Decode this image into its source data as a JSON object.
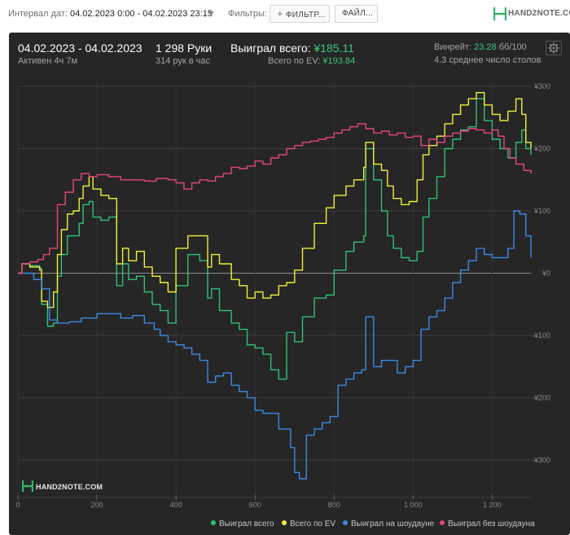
{
  "topbar": {
    "interval_label": "Интервал дат:",
    "date_range": "04.02.2023 0:00 - 04.02.2023 23:15",
    "filters_label": "Фильтры:",
    "filter_button": "ФИЛЬТР...",
    "file_button": "ФАЙЛ...",
    "brand": "HAND2NOTE.COM"
  },
  "summary": {
    "date": "04.02.2023 - 04.02.2023",
    "active": "Активен 4ч 7м",
    "hands": "1 298 Руки",
    "hands_rate": "314 рук в час",
    "won_label": "Выиграл всего:",
    "won_value": "¥185.11",
    "ev_label": "Всего по EV:",
    "ev_value": "¥193.84",
    "winrate_label": "Винрейт:",
    "winrate_value": "23.28",
    "winrate_unit": "бб/100",
    "tables": "4.3 среднее число столов"
  },
  "watermark": "HAND2NOTE.COM",
  "colors": {
    "green": "#2fc274",
    "yellow": "#f1f03a",
    "blue": "#3b8ae6",
    "pink": "#e5467e",
    "panel": "#262626"
  },
  "chart_data": {
    "type": "line",
    "xlabel": "",
    "ylabel": "",
    "xlim": [
      0,
      1298
    ],
    "ylim": [
      -360,
      300
    ],
    "x_ticks": [
      0,
      200,
      400,
      600,
      800,
      1000,
      1200
    ],
    "x_tick_labels": [
      "0",
      "200",
      "400",
      "600",
      "800",
      "1 000",
      "1 200"
    ],
    "y_ticks": [
      300,
      200,
      100,
      0,
      -100,
      -200,
      -300
    ],
    "y_tick_labels": [
      "¥300",
      "¥200",
      "¥100",
      "¥0",
      "-¥100",
      "-¥200",
      "-¥300"
    ],
    "legend_position": "bottom-right",
    "series": [
      {
        "name": "Выиграл всего",
        "color": "#2fc274",
        "points": [
          [
            0,
            0
          ],
          [
            10,
            15
          ],
          [
            30,
            12
          ],
          [
            55,
            8
          ],
          [
            60,
            -50
          ],
          [
            75,
            -85
          ],
          [
            90,
            -80
          ],
          [
            100,
            -5
          ],
          [
            110,
            30
          ],
          [
            125,
            60
          ],
          [
            140,
            60
          ],
          [
            155,
            80
          ],
          [
            165,
            110
          ],
          [
            180,
            115
          ],
          [
            190,
            90
          ],
          [
            210,
            85
          ],
          [
            230,
            90
          ],
          [
            250,
            -20
          ],
          [
            265,
            15
          ],
          [
            280,
            -10
          ],
          [
            300,
            -5
          ],
          [
            320,
            -30
          ],
          [
            340,
            -50
          ],
          [
            360,
            -60
          ],
          [
            380,
            -80
          ],
          [
            400,
            -20
          ],
          [
            430,
            30
          ],
          [
            460,
            20
          ],
          [
            480,
            -40
          ],
          [
            490,
            -25
          ],
          [
            510,
            -60
          ],
          [
            540,
            -80
          ],
          [
            560,
            -90
          ],
          [
            580,
            -115
          ],
          [
            600,
            -120
          ],
          [
            620,
            -130
          ],
          [
            640,
            -155
          ],
          [
            660,
            -170
          ],
          [
            680,
            -95
          ],
          [
            700,
            -110
          ],
          [
            720,
            -70
          ],
          [
            750,
            -40
          ],
          [
            780,
            -35
          ],
          [
            800,
            5
          ],
          [
            830,
            35
          ],
          [
            850,
            50
          ],
          [
            875,
            60
          ],
          [
            880,
            200
          ],
          [
            900,
            150
          ],
          [
            920,
            100
          ],
          [
            935,
            60
          ],
          [
            950,
            40
          ],
          [
            970,
            25
          ],
          [
            990,
            20
          ],
          [
            1010,
            35
          ],
          [
            1025,
            90
          ],
          [
            1040,
            120
          ],
          [
            1060,
            155
          ],
          [
            1080,
            200
          ],
          [
            1100,
            215
          ],
          [
            1120,
            230
          ],
          [
            1140,
            235
          ],
          [
            1160,
            280
          ],
          [
            1180,
            245
          ],
          [
            1200,
            215
          ],
          [
            1220,
            200
          ],
          [
            1240,
            185
          ],
          [
            1260,
            210
          ],
          [
            1275,
            230
          ],
          [
            1285,
            200
          ],
          [
            1298,
            190
          ]
        ]
      },
      {
        "name": "Всего по EV",
        "color": "#f1f03a",
        "points": [
          [
            0,
            0
          ],
          [
            10,
            15
          ],
          [
            30,
            10
          ],
          [
            55,
            5
          ],
          [
            60,
            -45
          ],
          [
            75,
            -55
          ],
          [
            90,
            -30
          ],
          [
            100,
            30
          ],
          [
            110,
            70
          ],
          [
            125,
            95
          ],
          [
            140,
            100
          ],
          [
            155,
            120
          ],
          [
            165,
            140
          ],
          [
            180,
            155
          ],
          [
            190,
            135
          ],
          [
            210,
            125
          ],
          [
            230,
            120
          ],
          [
            250,
            15
          ],
          [
            265,
            40
          ],
          [
            280,
            20
          ],
          [
            300,
            35
          ],
          [
            320,
            10
          ],
          [
            340,
            -5
          ],
          [
            360,
            -15
          ],
          [
            380,
            -30
          ],
          [
            400,
            40
          ],
          [
            430,
            60
          ],
          [
            460,
            60
          ],
          [
            480,
            10
          ],
          [
            490,
            30
          ],
          [
            510,
            15
          ],
          [
            540,
            -10
          ],
          [
            560,
            -20
          ],
          [
            580,
            -40
          ],
          [
            600,
            -30
          ],
          [
            620,
            -40
          ],
          [
            640,
            -35
          ],
          [
            660,
            -20
          ],
          [
            680,
            -15
          ],
          [
            700,
            5
          ],
          [
            720,
            40
          ],
          [
            750,
            80
          ],
          [
            780,
            105
          ],
          [
            800,
            125
          ],
          [
            830,
            140
          ],
          [
            850,
            150
          ],
          [
            875,
            170
          ],
          [
            880,
            210
          ],
          [
            900,
            175
          ],
          [
            920,
            165
          ],
          [
            935,
            140
          ],
          [
            950,
            120
          ],
          [
            970,
            110
          ],
          [
            990,
            115
          ],
          [
            1010,
            150
          ],
          [
            1025,
            190
          ],
          [
            1040,
            205
          ],
          [
            1060,
            220
          ],
          [
            1080,
            240
          ],
          [
            1100,
            255
          ],
          [
            1120,
            270
          ],
          [
            1140,
            280
          ],
          [
            1160,
            290
          ],
          [
            1180,
            270
          ],
          [
            1200,
            255
          ],
          [
            1220,
            245
          ],
          [
            1240,
            260
          ],
          [
            1260,
            280
          ],
          [
            1275,
            255
          ],
          [
            1285,
            210
          ],
          [
            1298,
            200
          ]
        ]
      },
      {
        "name": "Выиграл на шоудауне",
        "color": "#3b8ae6",
        "points": [
          [
            0,
            0
          ],
          [
            10,
            0
          ],
          [
            40,
            -10
          ],
          [
            60,
            -25
          ],
          [
            80,
            -75
          ],
          [
            100,
            -80
          ],
          [
            130,
            -78
          ],
          [
            160,
            -72
          ],
          [
            200,
            -65
          ],
          [
            230,
            -65
          ],
          [
            260,
            -72
          ],
          [
            290,
            -68
          ],
          [
            320,
            -80
          ],
          [
            345,
            -90
          ],
          [
            360,
            -100
          ],
          [
            380,
            -110
          ],
          [
            400,
            -115
          ],
          [
            420,
            -120
          ],
          [
            440,
            -130
          ],
          [
            460,
            -140
          ],
          [
            480,
            -175
          ],
          [
            500,
            -165
          ],
          [
            520,
            -160
          ],
          [
            540,
            -180
          ],
          [
            560,
            -190
          ],
          [
            580,
            -200
          ],
          [
            600,
            -220
          ],
          [
            620,
            -225
          ],
          [
            640,
            -225
          ],
          [
            660,
            -250
          ],
          [
            680,
            -250
          ],
          [
            690,
            -280
          ],
          [
            700,
            -320
          ],
          [
            712,
            -330
          ],
          [
            730,
            -260
          ],
          [
            750,
            -250
          ],
          [
            770,
            -240
          ],
          [
            790,
            -230
          ],
          [
            810,
            -180
          ],
          [
            830,
            -170
          ],
          [
            850,
            -160
          ],
          [
            870,
            -155
          ],
          [
            880,
            -70
          ],
          [
            900,
            -150
          ],
          [
            920,
            -140
          ],
          [
            940,
            -140
          ],
          [
            960,
            -160
          ],
          [
            980,
            -150
          ],
          [
            1000,
            -140
          ],
          [
            1020,
            -90
          ],
          [
            1040,
            -70
          ],
          [
            1060,
            -60
          ],
          [
            1080,
            -40
          ],
          [
            1100,
            -15
          ],
          [
            1120,
            5
          ],
          [
            1140,
            20
          ],
          [
            1160,
            40
          ],
          [
            1180,
            30
          ],
          [
            1200,
            25
          ],
          [
            1220,
            25
          ],
          [
            1240,
            40
          ],
          [
            1255,
            100
          ],
          [
            1270,
            95
          ],
          [
            1285,
            60
          ],
          [
            1298,
            25
          ]
        ]
      },
      {
        "name": "Выиграл без шоудауна",
        "color": "#e5467e",
        "points": [
          [
            0,
            0
          ],
          [
            10,
            15
          ],
          [
            30,
            18
          ],
          [
            50,
            22
          ],
          [
            65,
            30
          ],
          [
            80,
            40
          ],
          [
            100,
            110
          ],
          [
            120,
            130
          ],
          [
            140,
            150
          ],
          [
            160,
            160
          ],
          [
            180,
            155
          ],
          [
            200,
            158
          ],
          [
            230,
            155
          ],
          [
            260,
            150
          ],
          [
            290,
            150
          ],
          [
            320,
            148
          ],
          [
            350,
            152
          ],
          [
            380,
            150
          ],
          [
            400,
            145
          ],
          [
            420,
            135
          ],
          [
            440,
            145
          ],
          [
            460,
            150
          ],
          [
            480,
            148
          ],
          [
            500,
            155
          ],
          [
            520,
            160
          ],
          [
            540,
            170
          ],
          [
            560,
            168
          ],
          [
            580,
            172
          ],
          [
            600,
            180
          ],
          [
            620,
            175
          ],
          [
            640,
            185
          ],
          [
            660,
            190
          ],
          [
            680,
            200
          ],
          [
            700,
            205
          ],
          [
            720,
            210
          ],
          [
            740,
            212
          ],
          [
            760,
            215
          ],
          [
            780,
            218
          ],
          [
            800,
            225
          ],
          [
            820,
            230
          ],
          [
            840,
            235
          ],
          [
            860,
            240
          ],
          [
            880,
            232
          ],
          [
            900,
            225
          ],
          [
            920,
            228
          ],
          [
            940,
            222
          ],
          [
            960,
            225
          ],
          [
            980,
            218
          ],
          [
            1000,
            220
          ],
          [
            1020,
            205
          ],
          [
            1040,
            215
          ],
          [
            1060,
            210
          ],
          [
            1080,
            220
          ],
          [
            1100,
            225
          ],
          [
            1120,
            228
          ],
          [
            1140,
            232
          ],
          [
            1160,
            230
          ],
          [
            1180,
            225
          ],
          [
            1200,
            230
          ],
          [
            1215,
            220
          ],
          [
            1230,
            200
          ],
          [
            1245,
            185
          ],
          [
            1260,
            175
          ],
          [
            1280,
            165
          ],
          [
            1298,
            160
          ]
        ]
      }
    ]
  }
}
